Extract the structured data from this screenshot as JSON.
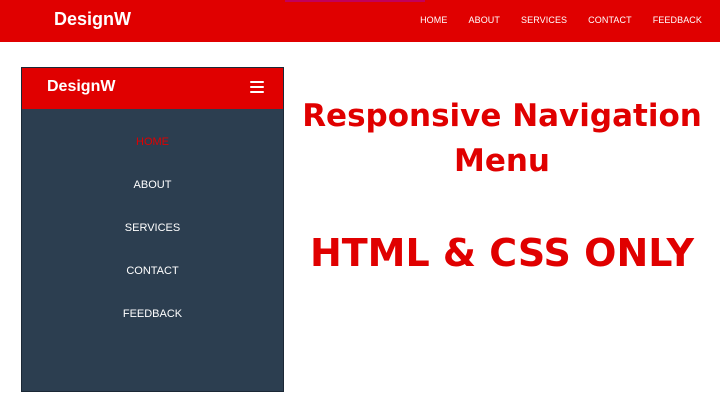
{
  "desktop": {
    "logo": "DesignW",
    "nav": [
      "HOME",
      "ABOUT",
      "SERVICES",
      "CONTACT",
      "FEEDBACK"
    ]
  },
  "mobile": {
    "logo": "DesignW",
    "menu_icon": "hamburger-icon",
    "nav": [
      "HOME",
      "ABOUT",
      "SERVICES",
      "CONTACT",
      "FEEDBACK"
    ],
    "active": "HOME"
  },
  "headline": {
    "line1": "Responsive Navigation",
    "line2": "Menu",
    "line3": "HTML & CSS ONLY"
  },
  "colors": {
    "brand_red": "#e00000",
    "mobile_bg": "#2c3e50",
    "text_light": "#ffffff"
  }
}
